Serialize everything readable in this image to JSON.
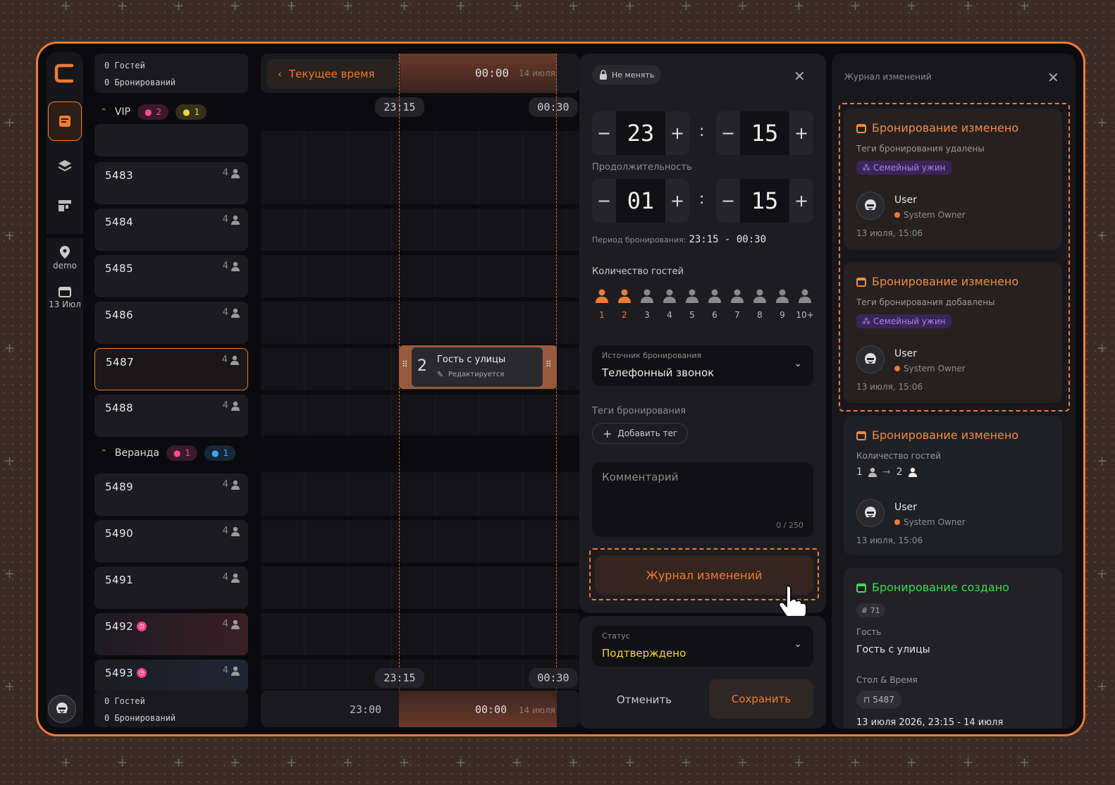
{
  "stats": {
    "guests": "0 Гостей",
    "bookings": "0 Бронирований"
  },
  "sidebar": {
    "location_label": "demo",
    "date_label": "13 Июл"
  },
  "timeline": {
    "now_button": "Текущее время",
    "top_time": "00:00",
    "top_date": "14 июля",
    "marker_start": "23:15",
    "marker_end": "00:30",
    "bottom_start": "23:15",
    "bottom_end": "00:30",
    "footer_time1": "23:00",
    "footer_time2": "00:00",
    "footer_date": "14 июля"
  },
  "sections": [
    {
      "name": "VIP",
      "badge_pink": "2",
      "badge_yellow": "1"
    },
    {
      "name": "Веранда",
      "badge_pink": "1",
      "badge_blue": "1"
    }
  ],
  "tables": [
    {
      "number": "5483",
      "capacity": "4"
    },
    {
      "number": "5484",
      "capacity": "4"
    },
    {
      "number": "5485",
      "capacity": "4"
    },
    {
      "number": "5486",
      "capacity": "4"
    },
    {
      "number": "5487",
      "capacity": "4"
    },
    {
      "number": "5488",
      "capacity": "4"
    },
    {
      "number": "5489",
      "capacity": "4"
    },
    {
      "number": "5490",
      "capacity": "4"
    },
    {
      "number": "5491",
      "capacity": "4"
    },
    {
      "number": "5492",
      "capacity": "4"
    },
    {
      "number": "5493",
      "capacity": "4"
    }
  ],
  "booking_block": {
    "guests": "2",
    "name": "Гость с улицы",
    "status": "Редактируется"
  },
  "editor": {
    "lock_label": "Не менять",
    "start_hours": "23",
    "start_minutes": "15",
    "duration_label": "Продолжительность",
    "duration_hours": "01",
    "duration_minutes": "15",
    "period_label": "Период бронирования:",
    "period_value": "23:15 - 00:30",
    "guests_label": "Количество гостей",
    "guest_options": [
      "1",
      "2",
      "3",
      "4",
      "5",
      "6",
      "7",
      "8",
      "9",
      "10+"
    ],
    "selected_guests": 2,
    "source_label": "Источник бронирования",
    "source_value": "Телефонный звонок",
    "tags_label": "Теги бронирования",
    "add_tag": "Добавить тег",
    "comment_placeholder": "Комментарий",
    "comment_counter": "0 / 250",
    "log_button": "Журнал изменений",
    "status_label": "Статус",
    "status_value": "Подтверждено",
    "cancel": "Отменить",
    "save": "Сохранить"
  },
  "log": {
    "title": "Журнал изменений",
    "entries": [
      {
        "title": "Бронирование изменено",
        "subtitle": "Теги бронирования удалены",
        "tag": "Семейный ужин",
        "user": "User",
        "role": "System Owner",
        "date": "13 июля, 15:06"
      },
      {
        "title": "Бронирование изменено",
        "subtitle": "Теги бронирования добавлены",
        "tag": "Семейный ужин",
        "user": "User",
        "role": "System Owner",
        "date": "13 июля, 15:06"
      },
      {
        "title": "Бронирование изменено",
        "subtitle": "Количество гостей",
        "from": "1",
        "to": "2",
        "user": "User",
        "role": "System Owner",
        "date": "13 июля, 15:06"
      }
    ],
    "created": {
      "title": "Бронирование создано",
      "id": "# 71",
      "guest_label": "Гость",
      "guest_value": "Гость с улицы",
      "table_label": "Стол & Время",
      "table_value": "5487",
      "datetime": "13 июля 2026, 23:15 - 14 июля"
    }
  },
  "colors": {
    "accent": "#ef7b36",
    "success": "#3ddc55",
    "status": "#f2d43a",
    "tag": "#b07ff0"
  }
}
